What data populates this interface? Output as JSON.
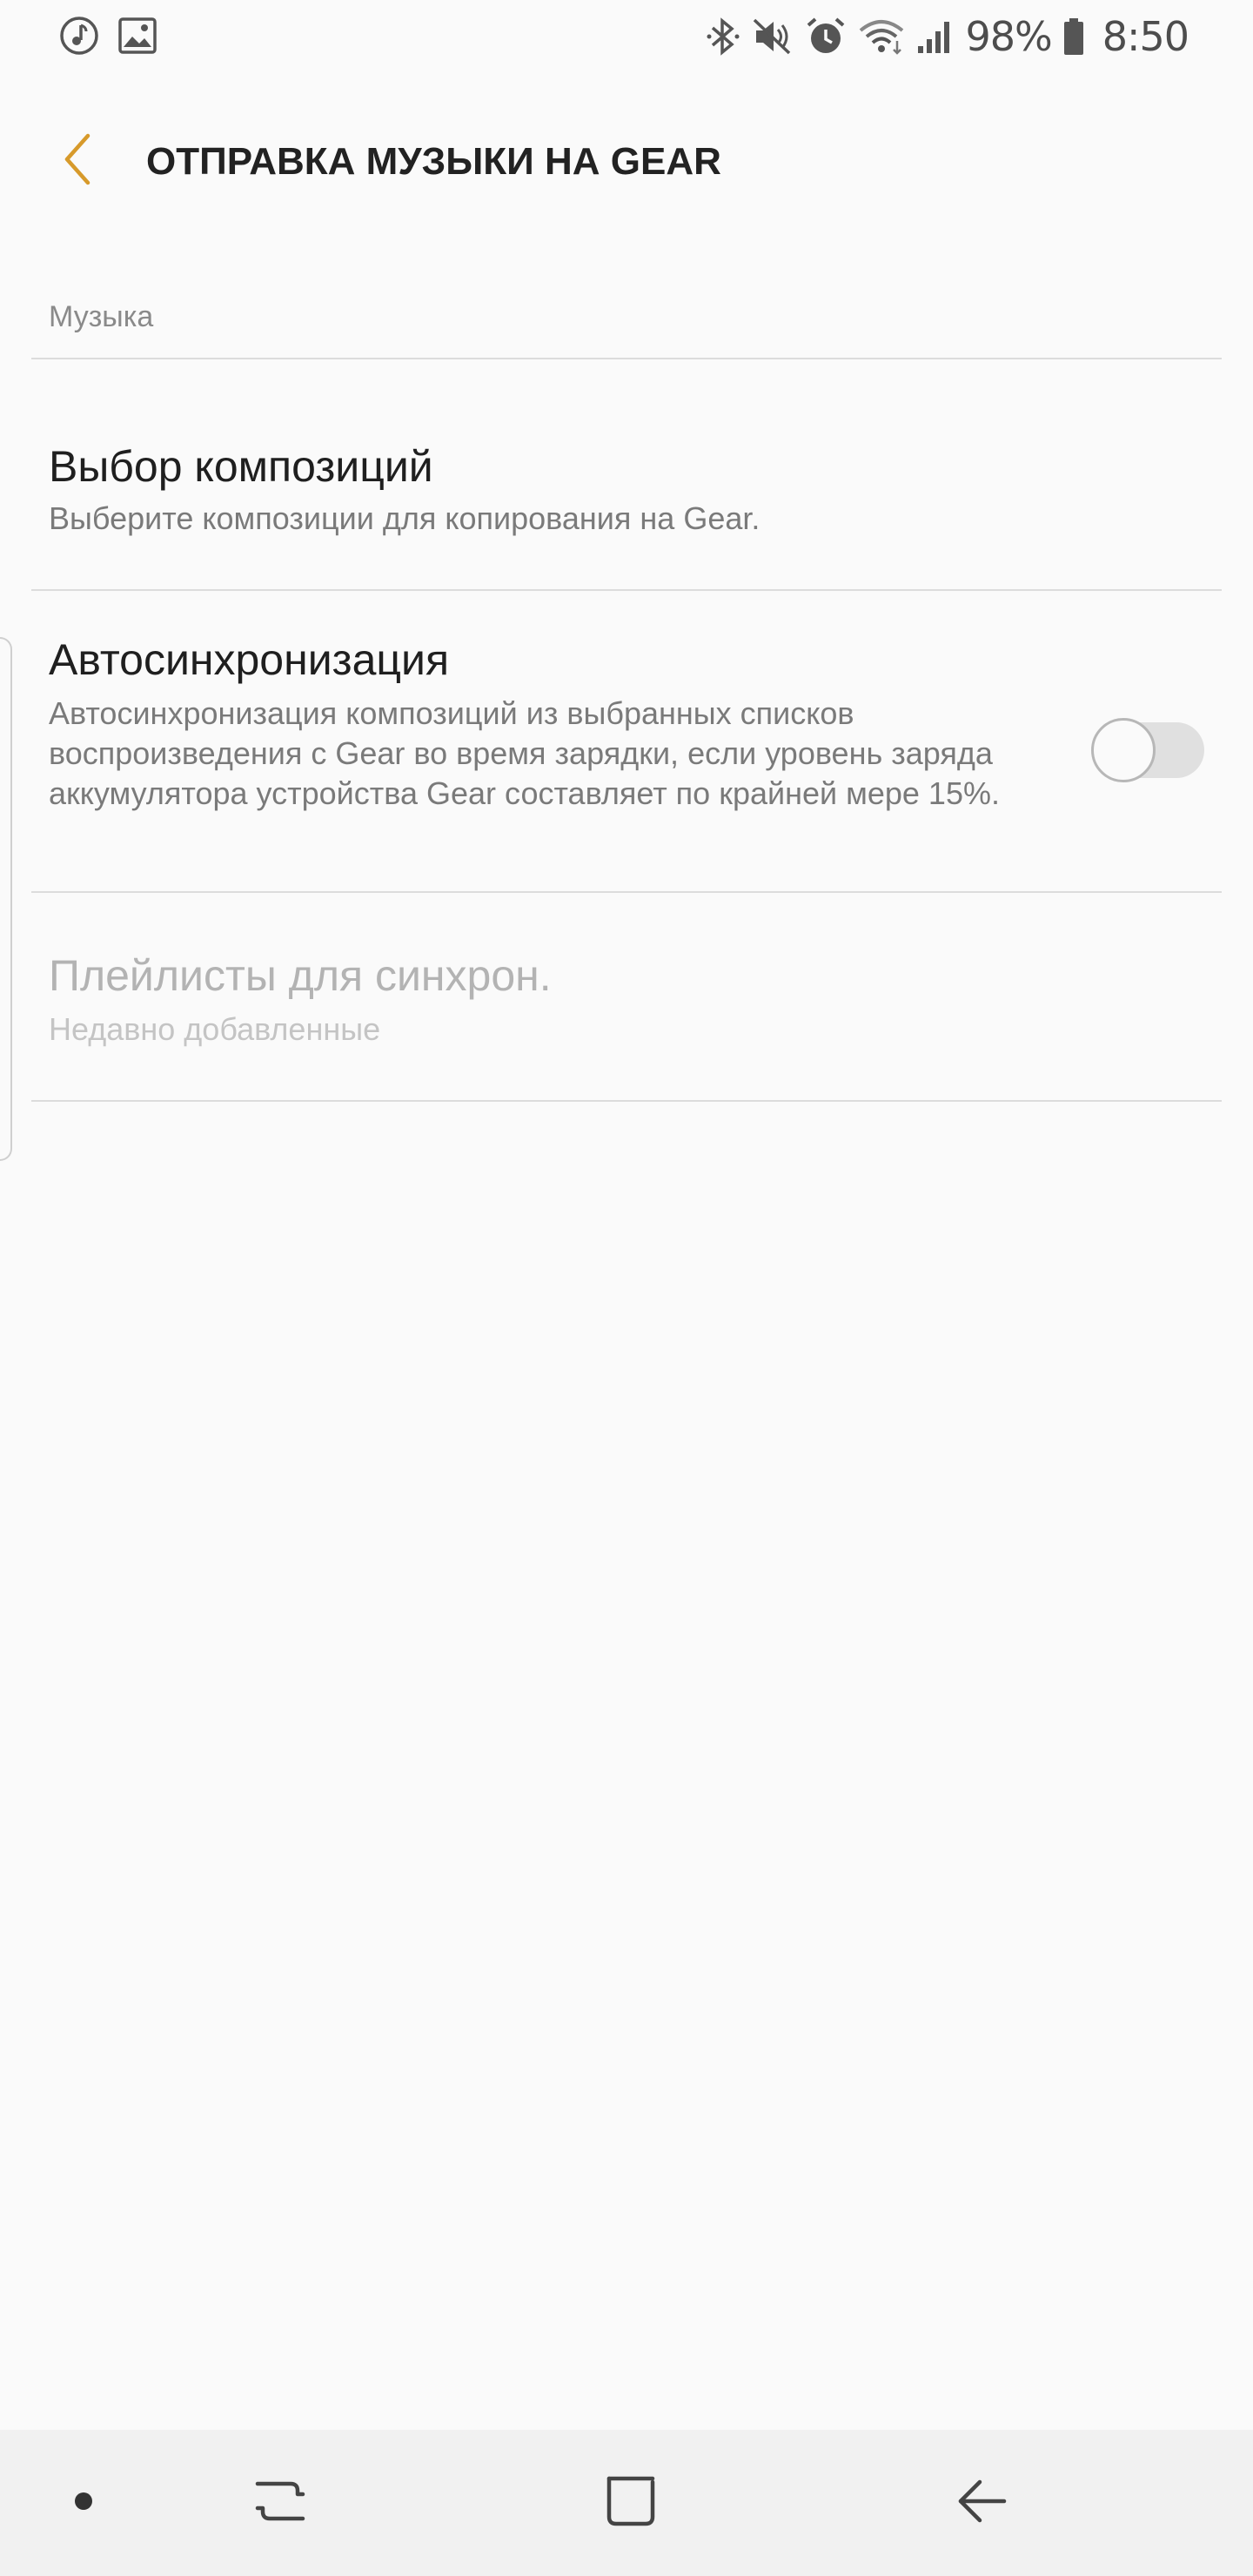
{
  "status_bar": {
    "left_icons": [
      "music-note-icon",
      "image-icon"
    ],
    "right_icons": [
      "bluetooth-icon",
      "mute-icon",
      "alarm-icon",
      "wifi-icon",
      "signal-icon",
      "battery-icon"
    ],
    "battery": "98%",
    "time": "8:50"
  },
  "app_bar": {
    "title": "ОТПРАВКА МУЗЫКИ НА GEAR",
    "accent_color": "#d79a2b"
  },
  "section": {
    "header": "Музыка"
  },
  "items": [
    {
      "title": "Выбор композиций",
      "subtitle": "Выберите композиции для копирования на Gear.",
      "enabled": true
    },
    {
      "title": "Автосинхронизация",
      "subtitle": "Автосинхронизация композиций из выбранных списков воспроизведения с Gear во время зарядки, если уровень заряда аккумулятора устройства Gear составляет по крайней мере 15%.",
      "toggle": false,
      "enabled": true
    },
    {
      "title": "Плейлисты для синхрон.",
      "subtitle": "Недавно добавленные",
      "enabled": false
    }
  ],
  "nav_bar": {
    "buttons": [
      "dot-icon",
      "recents-icon",
      "home-icon",
      "back-icon"
    ]
  }
}
